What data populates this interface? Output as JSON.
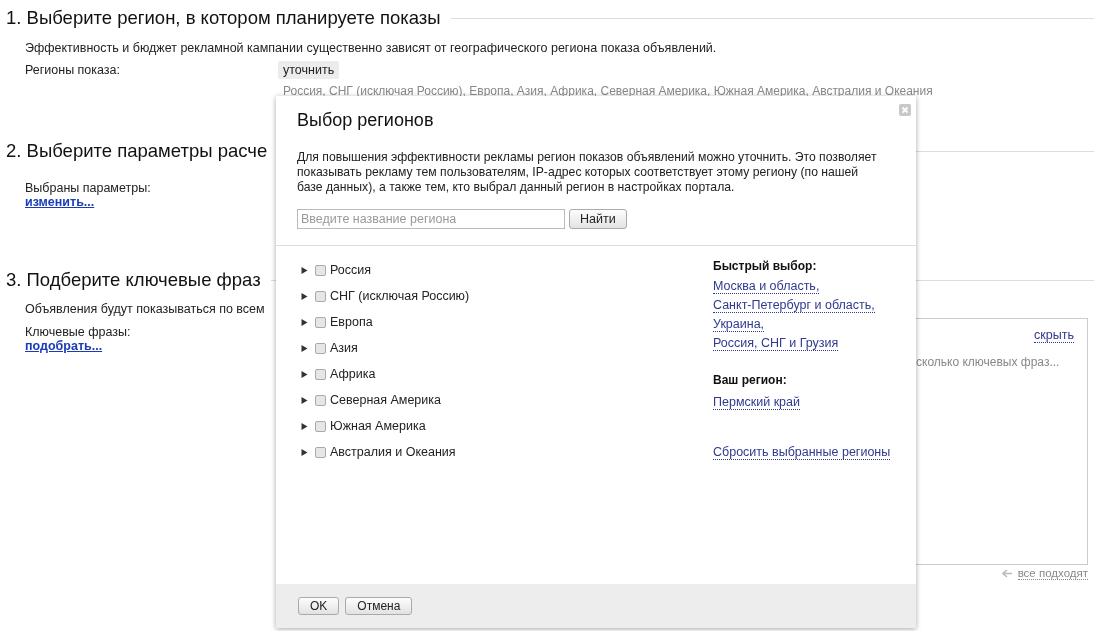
{
  "step1": {
    "title": "1. Выберите регион, в котором планируете показы",
    "description": "Эффективность и бюджет рекламной кампании существенно зависят от географического региона показа объявлений.",
    "label": "Регионы показа:",
    "refine_button": "уточнить",
    "regions_summary": "Россия, СНГ (исключая Россию), Европа, Азия, Африка, Северная Америка, Южная Америка, Австралия и Океания"
  },
  "step2": {
    "title": "2. Выберите параметры расче",
    "label": "Выбраны параметры:",
    "link": "изменить..."
  },
  "step3": {
    "title": "3. Подберите ключевые фраз",
    "description": "Объявления будут показываться по всем",
    "label": "Ключевые фразы:",
    "link": "подобрать...",
    "hide_link": "скрыть",
    "placeholder": "сколько ключевых фраз...",
    "all_fit_link": "все подходят"
  },
  "dialog": {
    "title": "Выбор регионов",
    "description": "Для повышения эффективности рекламы регион показов объявлений можно уточнить. Это позволяет показывать рекламу тем пользователям, IP-адрес которых соответствует этому региону (по нашей базе данных), а также тем, кто выбрал данный регион в настройках портала.",
    "search": {
      "placeholder": "Введите название региона"
    },
    "search_button": "Найти",
    "regions": [
      {
        "label": "Россия",
        "expanded": false,
        "checked": false
      },
      {
        "label": "СНГ (исключая Россию)",
        "expanded": false,
        "checked": false
      },
      {
        "label": "Европа",
        "expanded": false,
        "checked": false
      },
      {
        "label": "Азия",
        "expanded": false,
        "checked": false
      },
      {
        "label": "Африка",
        "expanded": false,
        "checked": false
      },
      {
        "label": "Северная Америка",
        "expanded": false,
        "checked": false
      },
      {
        "label": "Южная Америка",
        "expanded": false,
        "checked": false
      },
      {
        "label": "Австралия и Океания",
        "expanded": false,
        "checked": false
      }
    ],
    "quick_title": "Быстрый выбор:",
    "quick_links": [
      "Москва и область,",
      "Санкт-Петербург и область,",
      "Украина,",
      "Россия, СНГ и Грузия"
    ],
    "your_region_title": "Ваш регион:",
    "your_region": "Пермский край",
    "reset_link": "Сбросить выбранные регионы",
    "buttons": [
      "OK",
      "Отмена"
    ]
  }
}
